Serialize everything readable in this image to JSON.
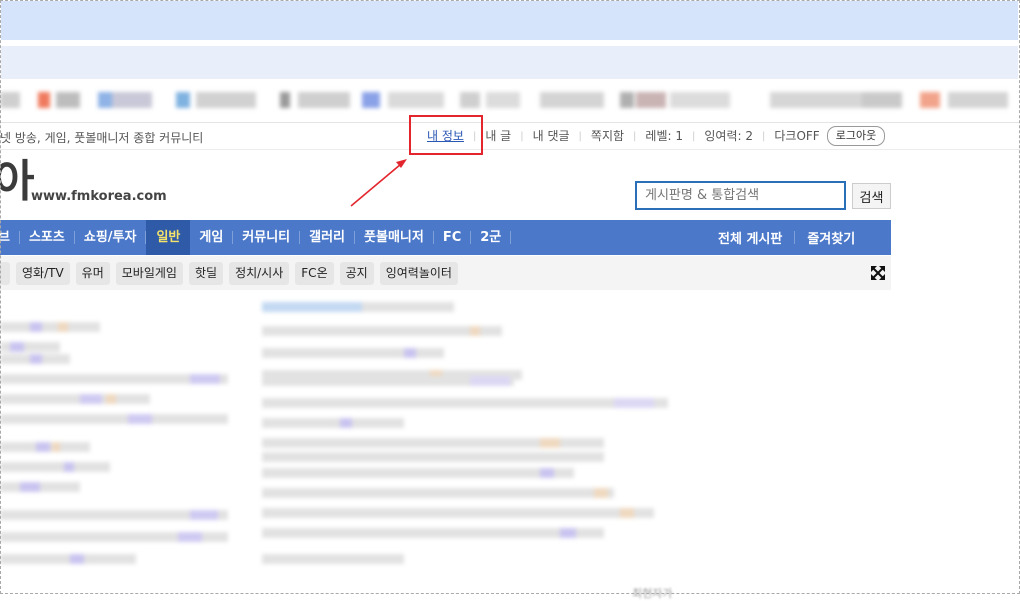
{
  "header": {
    "tagline": "넷 방송, 게임, 풋볼매니저 종합 커뮤니티"
  },
  "user_menu": {
    "my_info": "내 정보",
    "my_posts": "내 글",
    "my_comments": "내 댓글",
    "messages": "쪽지함",
    "level": "레벨: 1",
    "surplus_power": "잉여력: 2",
    "dark_mode": "다크OFF",
    "logout": "로그아웃"
  },
  "logo": {
    "char": "아",
    "url": "www.fmkorea.com"
  },
  "search": {
    "placeholder": "게시판명 & 통합검색",
    "button": "검색"
  },
  "main_nav": {
    "items": [
      "브",
      "스포츠",
      "쇼핑/투자",
      "일반",
      "게임",
      "커뮤니티",
      "갤러리",
      "풋볼매니저",
      "FC",
      "2군"
    ],
    "active": "일반",
    "right": [
      "전체 게시판",
      "즐겨찾기"
    ]
  },
  "sub_nav": {
    "items": [
      "영화/TV",
      "유머",
      "모바일게임",
      "핫딜",
      "정치/시사",
      "FC온",
      "공지",
      "잉여력놀이터"
    ]
  },
  "footer": {
    "text": "최현자가"
  },
  "colors": {
    "nav_bg": "#4b78c9",
    "nav_active_bg": "#2e5aa8",
    "nav_active_text": "#f3e36a",
    "highlight": "#e3262e",
    "search_border": "#2a6fb8",
    "link": "#2a56b4"
  },
  "icons": {
    "expand": "expand-arrows-icon"
  }
}
